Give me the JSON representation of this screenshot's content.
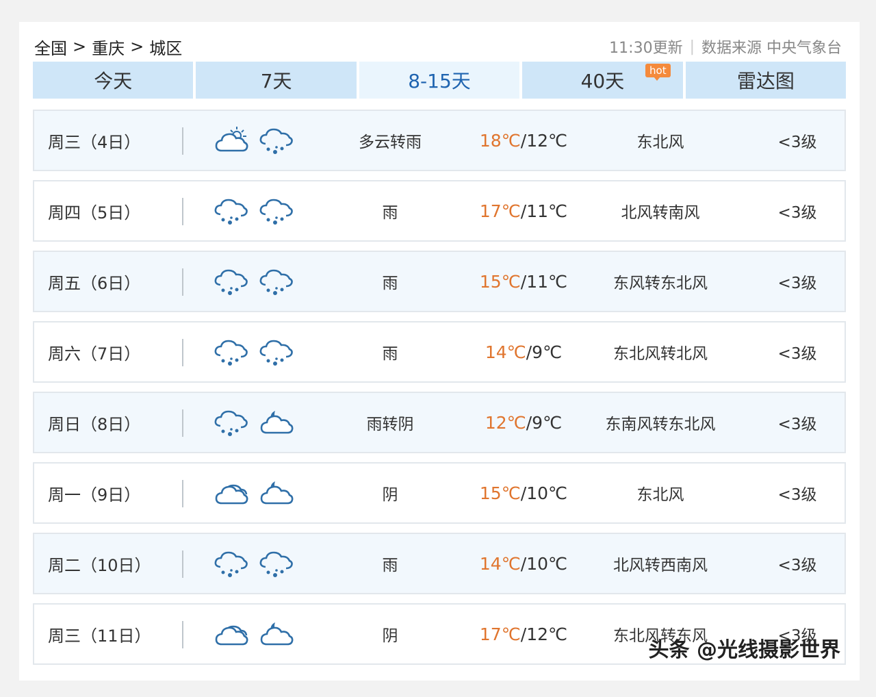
{
  "breadcrumb": {
    "items": [
      "全国",
      "重庆",
      "城区"
    ],
    "separator": ">"
  },
  "meta": {
    "update": "11:30更新",
    "source": "数据来源 中央气象台"
  },
  "tabs": [
    {
      "label": "今天",
      "active": false
    },
    {
      "label": "7天",
      "active": false
    },
    {
      "label": "8-15天",
      "active": true
    },
    {
      "label": "40天",
      "active": false,
      "badge": "hot"
    },
    {
      "label": "雷达图",
      "active": false
    }
  ],
  "forecast": [
    {
      "date": "周三（4日）",
      "icon_day": "partly-cloudy-day-icon",
      "icon_night": "rain-icon",
      "desc": "多云转雨",
      "high": "18℃",
      "low": "12℃",
      "wind": "东北风",
      "level": "<3级"
    },
    {
      "date": "周四（5日）",
      "icon_day": "rain-icon",
      "icon_night": "rain-icon",
      "desc": "雨",
      "high": "17℃",
      "low": "11℃",
      "wind": "北风转南风",
      "level": "<3级"
    },
    {
      "date": "周五（6日）",
      "icon_day": "rain-icon",
      "icon_night": "rain-icon",
      "desc": "雨",
      "high": "15℃",
      "low": "11℃",
      "wind": "东风转东北风",
      "level": "<3级"
    },
    {
      "date": "周六（7日）",
      "icon_day": "rain-icon",
      "icon_night": "rain-icon",
      "desc": "雨",
      "high": "14℃",
      "low": "9℃",
      "wind": "东北风转北风",
      "level": "<3级"
    },
    {
      "date": "周日（8日）",
      "icon_day": "rain-icon",
      "icon_night": "cloudy-night-icon",
      "desc": "雨转阴",
      "high": "12℃",
      "low": "9℃",
      "wind": "东南风转东北风",
      "level": "<3级"
    },
    {
      "date": "周一（9日）",
      "icon_day": "overcast-icon",
      "icon_night": "cloudy-night-icon",
      "desc": "阴",
      "high": "15℃",
      "low": "10℃",
      "wind": "东北风",
      "level": "<3级"
    },
    {
      "date": "周二（10日）",
      "icon_day": "rain-icon",
      "icon_night": "rain-icon",
      "desc": "雨",
      "high": "14℃",
      "low": "10℃",
      "wind": "北风转西南风",
      "level": "<3级"
    },
    {
      "date": "周三（11日）",
      "icon_day": "overcast-icon",
      "icon_night": "cloudy-night-icon",
      "desc": "阴",
      "high": "17℃",
      "low": "12℃",
      "wind": "东北风转东风",
      "level": "<3级"
    }
  ],
  "watermark": "头条 @光线摄影世界",
  "colors": {
    "tab_bg": "#cfe6f8",
    "tab_active": "#eaf5fd",
    "tab_active_text": "#1f64b0",
    "high_temp": "#e0752e",
    "hot_badge": "#f48a3c",
    "icon_blue": "#2f6fa8"
  }
}
